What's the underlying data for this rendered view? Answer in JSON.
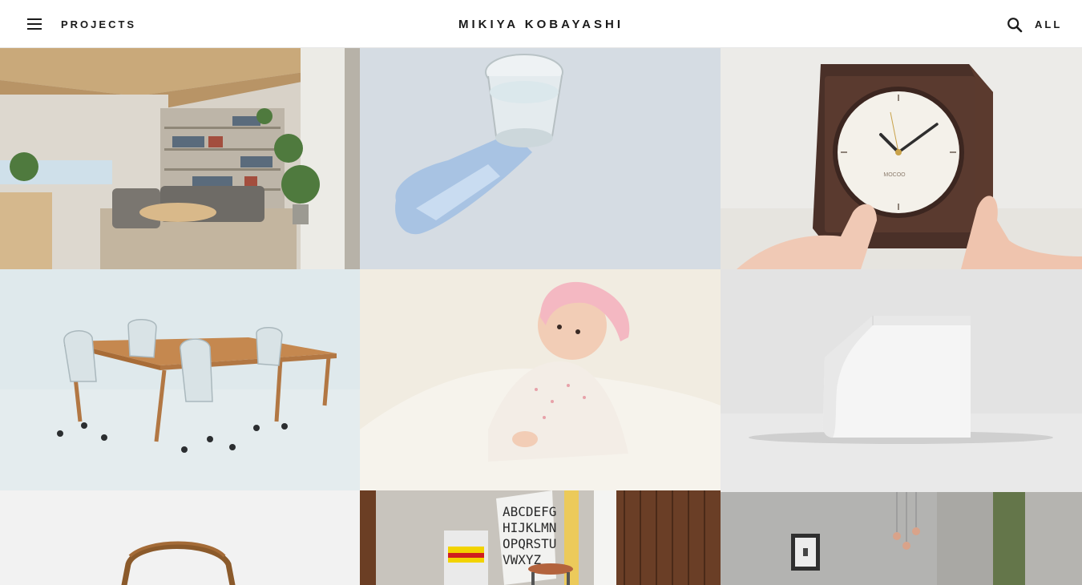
{
  "header": {
    "menu_icon": "hamburger-menu-icon",
    "projects_label": "PROJECTS",
    "brand": "MIKIYA KOBAYASHI",
    "search_icon": "search-icon",
    "filter_label": "ALL"
  },
  "projects": [
    {
      "image": "living-room-interior"
    },
    {
      "image": "water-glass-with-shadow"
    },
    {
      "image": "wooden-clock",
      "clock_brand": "MOCOO"
    },
    {
      "image": "meeting-table-and-chairs"
    },
    {
      "image": "baby-with-pink-helmet"
    },
    {
      "image": "white-box-product"
    },
    {
      "image": "wooden-chair"
    },
    {
      "image": "alphabet-poster-stool",
      "poster_lines": [
        "ABCDEFG",
        "HIJKLMN",
        "OPQRSTU",
        "VWXYZ"
      ]
    },
    {
      "image": "bedroom-pendant-lights"
    }
  ],
  "colors": {
    "background": "#ffffff",
    "text": "#1a1a1a",
    "divider": "#e6e6e6"
  }
}
